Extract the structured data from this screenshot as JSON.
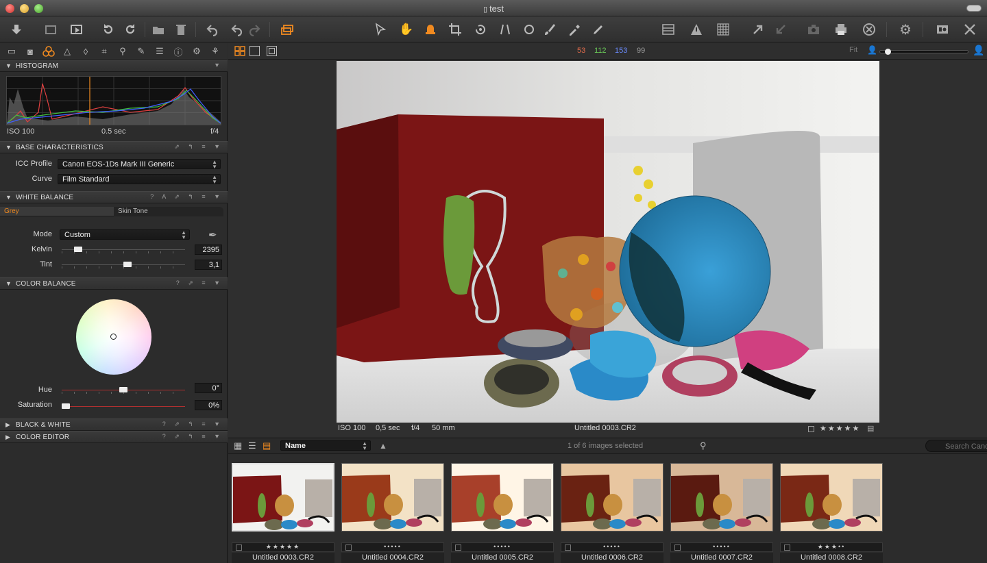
{
  "window": {
    "title": "test"
  },
  "colors": {
    "accent": "#f08a20",
    "r": "#e06b4b",
    "g": "#6ccf5a",
    "b": "#6b8cff"
  },
  "rgb_readout": {
    "r": "53",
    "g": "112",
    "b": "153",
    "l": "99"
  },
  "viewer_header": {
    "fit_label": "Fit"
  },
  "histogram": {
    "iso": "ISO 100",
    "shutter": "0.5 sec",
    "aperture": "f/4"
  },
  "sections": {
    "histogram": "HISTOGRAM",
    "base": "BASE CHARACTERISTICS",
    "white_balance": "WHITE BALANCE",
    "color_balance": "COLOR BALANCE",
    "bw": "BLACK & WHITE",
    "color_editor": "COLOR EDITOR"
  },
  "base": {
    "icc_label": "ICC Profile",
    "icc_value": "Canon EOS-1Ds Mark III Generic",
    "curve_label": "Curve",
    "curve_value": "Film Standard"
  },
  "white_balance": {
    "tab_grey": "Grey",
    "tab_skin": "Skin Tone",
    "mode_label": "Mode",
    "mode_value": "Custom",
    "kelvin_label": "Kelvin",
    "kelvin_value": "2395",
    "tint_label": "Tint",
    "tint_value": "3,1"
  },
  "color_balance": {
    "hue_label": "Hue",
    "hue_value": "0°",
    "sat_label": "Saturation",
    "sat_value": "0%"
  },
  "viewer_info": {
    "iso": "ISO 100",
    "shutter": "0,5 sec",
    "aperture": "f/4",
    "focal": "50 mm",
    "filename": "Untitled 0003.CR2",
    "stars": "★★★★★"
  },
  "browser": {
    "sort_label": "Name",
    "count": "1 of 6 images selected",
    "search_placeholder": "Search Canon"
  },
  "thumbnails": [
    {
      "name": "Untitled 0003.CR2",
      "stars": "★★★★★"
    },
    {
      "name": "Untitled 0004.CR2",
      "stars": "•••••"
    },
    {
      "name": "Untitled 0005.CR2",
      "stars": "•••••"
    },
    {
      "name": "Untitled 0006.CR2",
      "stars": "•••••"
    },
    {
      "name": "Untitled 0007.CR2",
      "stars": "•••••"
    },
    {
      "name": "Untitled 0008.CR2",
      "stars": "★★★••"
    }
  ]
}
